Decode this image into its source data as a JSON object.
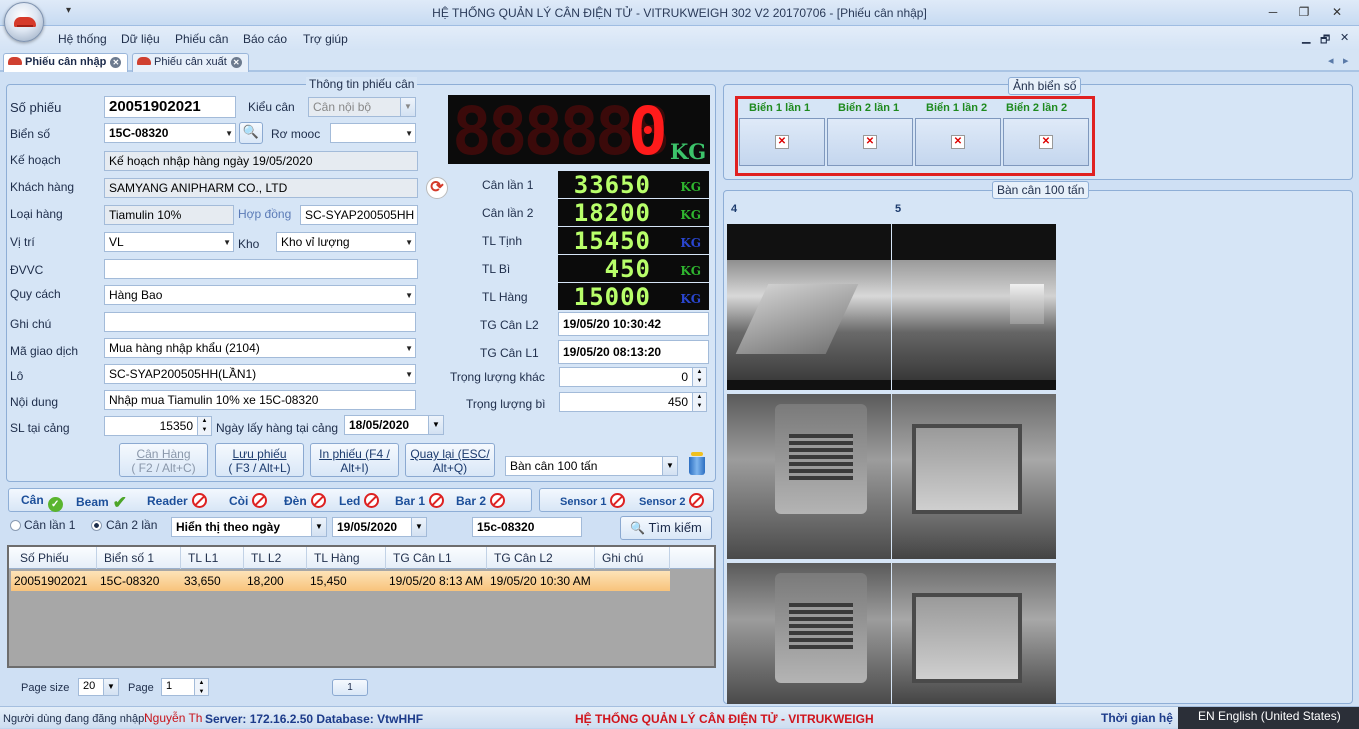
{
  "window": {
    "title": "HỆ THỐNG QUẢN LÝ CÂN ĐIỆN TỬ - VITRUKWEIGH 302 V2 20170706 - [Phiếu cân nhập]",
    "qat": "▾",
    "min": "─",
    "restore": "❐",
    "close": "✕"
  },
  "menu": [
    "Hệ thống",
    "Dữ liệu",
    "Phiếu cân",
    "Báo cáo",
    "Trợ giúp"
  ],
  "mdi_controls": {
    "min": "▁",
    "restore": "🗗",
    "close": "✕"
  },
  "tabs": [
    {
      "label": "Phiếu cân nhập"
    },
    {
      "label": "Phiếu cân xuất"
    }
  ],
  "tab_nav": {
    "prev": "◂",
    "next": "▸"
  },
  "form": {
    "legend": "Thông tin phiếu cân",
    "so_phieu": {
      "label": "Số phiếu",
      "value": "20051902021"
    },
    "kieu_can": {
      "label": "Kiểu cân",
      "value": "Cân nội bộ"
    },
    "bien_so": {
      "label": "Biển số",
      "value": "15C-08320"
    },
    "ro_mooc": {
      "label": "Rơ mooc",
      "value": ""
    },
    "ke_hoach": {
      "label": "Kế hoạch",
      "value": "Kế hoạch nhập hàng ngày 19/05/2020"
    },
    "khach_hang": {
      "label": "Khách hàng",
      "value": "SAMYANG ANIPHARM CO., LTD"
    },
    "loai_hang": {
      "label": "Loại hàng",
      "value": "Tiamulin 10%"
    },
    "hop_dong": {
      "label": "Hợp đồng",
      "value": "SC-SYAP200505HH"
    },
    "vi_tri": {
      "label": "Vị trí",
      "value": "VL"
    },
    "kho": {
      "label": "Kho",
      "value": "Kho vỉ lượng"
    },
    "dvvc": {
      "label": "ĐVVC",
      "value": ""
    },
    "quy_cach": {
      "label": "Quy cách",
      "value": "Hàng Bao"
    },
    "ghi_chu": {
      "label": "Ghi chú",
      "value": ""
    },
    "ma_giao_dich": {
      "label": "Mã giao dịch",
      "value": "Mua hàng nhập khẩu (2104)"
    },
    "lo": {
      "label": "Lô",
      "value": "SC-SYAP200505HH(LẦN1)"
    },
    "noi_dung": {
      "label": "Nội dung",
      "value": "Nhập mua Tiamulin 10% xe 15C-08320"
    },
    "sl_tai_cang": {
      "label": "SL tại cảng",
      "value": "15350"
    },
    "ngay_lay_hang": {
      "label": "Ngày lấy hàng tại cảng",
      "value": "18/05/2020"
    }
  },
  "display": {
    "main": {
      "value": "0",
      "ghost": "888888",
      "unit": "KG"
    }
  },
  "weights": [
    {
      "label": "Cân lần 1",
      "value": "33650",
      "unit": "KG",
      "unit_color": "#2fb52f"
    },
    {
      "label": "Cân lần 2",
      "value": "18200",
      "unit": "KG",
      "unit_color": "#2fb52f"
    },
    {
      "label": "TL Tịnh",
      "value": "15450",
      "unit": "KG",
      "unit_color": "#2a46d0"
    },
    {
      "label": "TL Bì",
      "value": "450",
      "unit": "KG",
      "unit_color": "#2fb52f"
    },
    {
      "label": "TL Hàng",
      "value": "15000",
      "unit": "KG",
      "unit_color": "#2a46d0"
    }
  ],
  "times": [
    {
      "label": "TG Cân L2",
      "value": "19/05/20 10:30:42"
    },
    {
      "label": "TG Cân L1",
      "value": "19/05/20 08:13:20"
    }
  ],
  "extra": [
    {
      "label": "Trọng lượng khác",
      "value": "0"
    },
    {
      "label": "Trọng lượng bì",
      "value": "450"
    }
  ],
  "buttons": {
    "can_hang": {
      "line1": "Cân Hàng",
      "line2": "( F2 / Alt+C)"
    },
    "luu_phieu": {
      "line1": "Lưu phiếu",
      "line2": "( F3 / Alt+L)"
    },
    "in_phieu": {
      "line1": "In phiếu (F4 /",
      "line2": "Alt+I)"
    },
    "quay_lai": {
      "line1": "Quay lại (ESC/",
      "line2": "Alt+Q)"
    }
  },
  "scale_select": "Bàn cân 100 tấn",
  "status_items": [
    {
      "label": "Cân",
      "state": "ok"
    },
    {
      "label": "Beam",
      "state": "check"
    },
    {
      "label": "Reader",
      "state": "off"
    },
    {
      "label": "Còi",
      "state": "off"
    },
    {
      "label": "Đèn",
      "state": "off"
    },
    {
      "label": "Led",
      "state": "off"
    },
    {
      "label": "Bar 1",
      "state": "off"
    },
    {
      "label": "Bar 2",
      "state": "off"
    }
  ],
  "sensors": [
    {
      "label": "Sensor 1",
      "state": "off"
    },
    {
      "label": "Sensor 2",
      "state": "off"
    }
  ],
  "filter": {
    "radio1": "Cân lần 1",
    "radio2": "Cân 2 lần",
    "mode": "Hiển thị theo ngày",
    "date": "19/05/2020",
    "plate": "15c-08320",
    "search": "Tìm kiếm"
  },
  "table": {
    "columns": [
      "Số Phiếu",
      "Biển số 1",
      "TL L1",
      "TL L2",
      "TL Hàng",
      "TG Cân L1",
      "TG Cân L2",
      "Ghi chú"
    ],
    "rows": [
      [
        "20051902021",
        "15C-08320",
        "33,650",
        "18,200",
        "15,450",
        "19/05/20 8:13 AM",
        "19/05/20 10:30 AM",
        ""
      ]
    ]
  },
  "pager": {
    "size_label": "Page size",
    "size": "20",
    "page_label": "Page",
    "page": "1",
    "page_btn": "1"
  },
  "plates": {
    "legend": "Ảnh biển số",
    "items": [
      "Biển 1 lần 1",
      "Biển 2 lần 1",
      "Biển 1 lần 2",
      "Biển 2 lần 2"
    ]
  },
  "cameras": {
    "legend": "Bàn cân 100 tấn",
    "col1": "4",
    "col2": "5"
  },
  "statusbar": {
    "user_label": "Người dùng đang đăng nhập:",
    "user": "Nguyễn Th",
    "server": "Server: 172.16.2.50 Database: VtwHHF",
    "center": "HỆ THỐNG QUẢN LÝ CÂN ĐIỆN TỬ - VITRUKWEIGH",
    "time_label": "Thời gian hệ",
    "lang": "EN English (United States)"
  }
}
